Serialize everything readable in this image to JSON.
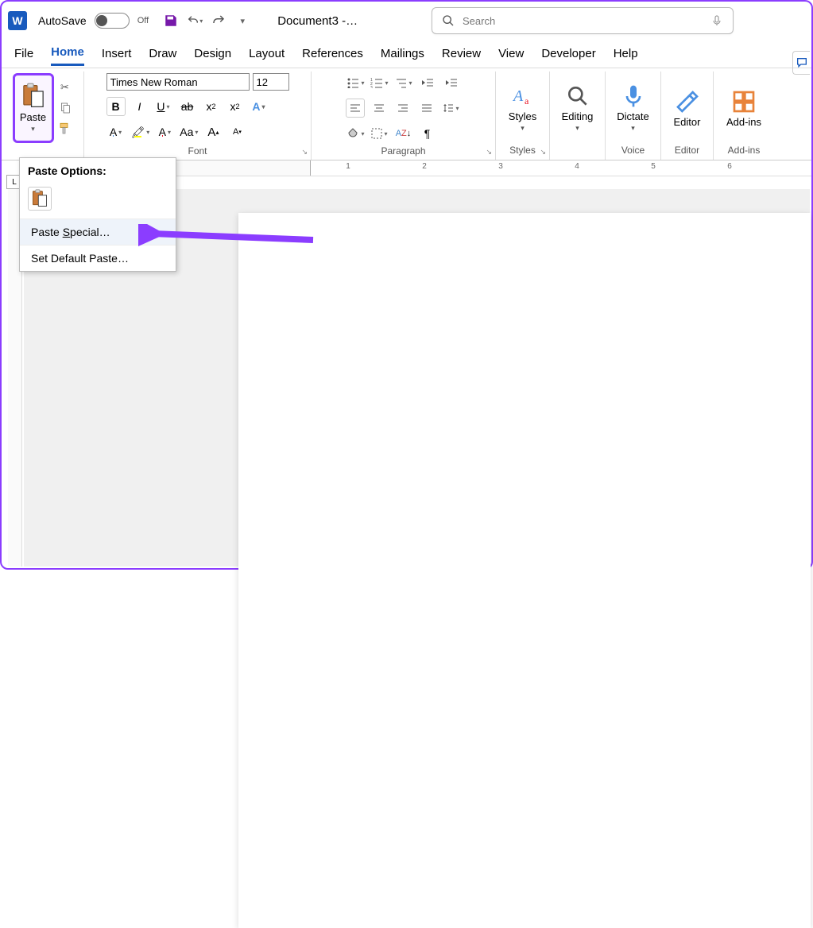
{
  "titlebar": {
    "autosave_label": "AutoSave",
    "toggle_state": "Off",
    "doc_title": "Document3 -…",
    "search_placeholder": "Search"
  },
  "tabs": [
    "File",
    "Home",
    "Insert",
    "Draw",
    "Design",
    "Layout",
    "References",
    "Mailings",
    "Review",
    "View",
    "Developer",
    "Help"
  ],
  "active_tab": "Home",
  "ribbon": {
    "clipboard": {
      "paste_label": "Paste"
    },
    "font": {
      "name": "Times New Roman",
      "size": "12",
      "group_label": "Font"
    },
    "paragraph": {
      "group_label": "Paragraph"
    },
    "styles": {
      "big_label": "Styles",
      "group_label": "Styles"
    },
    "editing": {
      "label": "Editing"
    },
    "dictate": {
      "label": "Dictate",
      "group_label": "Voice"
    },
    "editor": {
      "label": "Editor",
      "group_label": "Editor"
    },
    "addins": {
      "label": "Add-ins",
      "group_label": "Add-ins"
    }
  },
  "paste_menu": {
    "title": "Paste Options:",
    "special": "Paste Special…",
    "default": "Set Default Paste…"
  },
  "ruler_numbers": [
    "1",
    "2",
    "3",
    "4",
    "5",
    "6"
  ]
}
